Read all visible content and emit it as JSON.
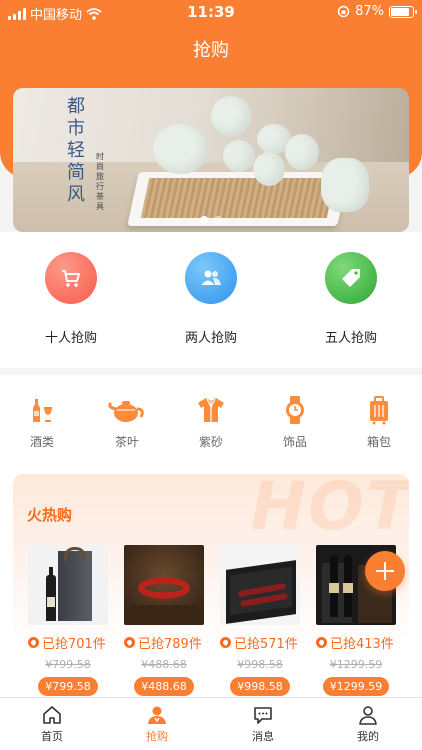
{
  "status_bar": {
    "carrier": "中国移动",
    "time": "11:39",
    "battery": "87%",
    "battery_level": 0.87
  },
  "nav": {
    "title": "抢购"
  },
  "banner": {
    "title": "都市轻简风",
    "subtitle": "时尚旅行茶具",
    "dot_count": 2,
    "active_dot": 0
  },
  "group_buy": [
    {
      "label": "十人抢购",
      "icon": "cart-icon",
      "color": "#fa6e5c"
    },
    {
      "label": "两人抢购",
      "icon": "users-icon",
      "color": "#3fa6f2"
    },
    {
      "label": "五人抢购",
      "icon": "tag-icon",
      "color": "#3cb640"
    }
  ],
  "categories": [
    {
      "label": "酒类",
      "icon": "wine-icon"
    },
    {
      "label": "茶叶",
      "icon": "teapot-icon"
    },
    {
      "label": "紫砂",
      "icon": "shirt-icon"
    },
    {
      "label": "饰品",
      "icon": "watch-icon"
    },
    {
      "label": "箱包",
      "icon": "luggage-icon"
    }
  ],
  "hot": {
    "watermark": "HOT",
    "title": "火热购",
    "products": [
      {
        "sold": "已抢701件",
        "old_price": "¥799.58",
        "price": "¥799.58"
      },
      {
        "sold": "已抢789件",
        "old_price": "¥488.68",
        "price": "¥488.68"
      },
      {
        "sold": "已抢571件",
        "old_price": "¥998.58",
        "price": "¥998.58"
      },
      {
        "sold": "已抢413件",
        "old_price": "¥1299.59",
        "price": "¥1299.59"
      }
    ]
  },
  "tabbar": [
    {
      "label": "首页",
      "icon": "home-icon",
      "active": false
    },
    {
      "label": "抢购",
      "icon": "flash-sale-icon",
      "active": true
    },
    {
      "label": "消息",
      "icon": "message-icon",
      "active": false
    },
    {
      "label": "我的",
      "icon": "profile-icon",
      "active": false
    }
  ],
  "colors": {
    "primary": "#fb7f32",
    "hot_text": "#fb6a1e"
  }
}
